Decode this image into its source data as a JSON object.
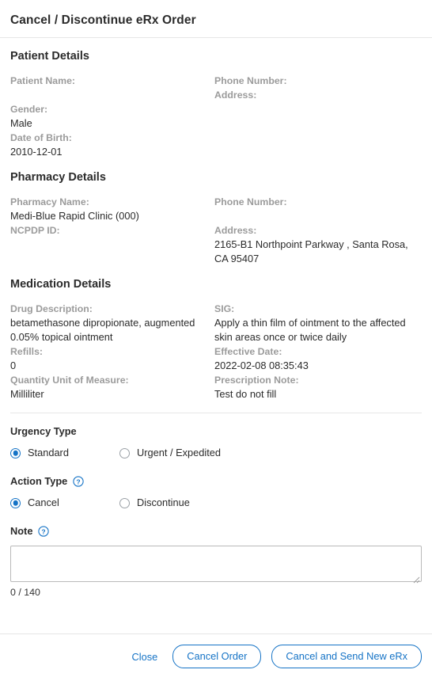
{
  "modal": {
    "title": "Cancel / Discontinue eRx Order"
  },
  "patient_details": {
    "heading": "Patient Details",
    "patient_name_label": "Patient Name:",
    "patient_name_value": "",
    "phone_number_label": "Phone Number:",
    "phone_number_value": "",
    "address_label": "Address:",
    "address_value": "",
    "gender_label": "Gender:",
    "gender_value": "Male",
    "dob_label": "Date of Birth:",
    "dob_value": "2010-12-01"
  },
  "pharmacy_details": {
    "heading": "Pharmacy Details",
    "pharmacy_name_label": "Pharmacy Name:",
    "pharmacy_name_value": "Medi-Blue Rapid Clinic (000)",
    "ncpdp_label": "NCPDP ID:",
    "ncpdp_value": "",
    "phone_number_label": "Phone Number:",
    "phone_number_value": "",
    "address_label": "Address:",
    "address_value": "2165-B1 Northpoint Parkway , Santa Rosa, CA 95407"
  },
  "medication_details": {
    "heading": "Medication Details",
    "drug_description_label": "Drug Description:",
    "drug_description_value": "betamethasone dipropionate, augmented 0.05% topical ointment",
    "refills_label": "Refills:",
    "refills_value": "0",
    "quantity_unit_label": "Quantity Unit of Measure:",
    "quantity_unit_value": "Milliliter",
    "sig_label": "SIG:",
    "sig_value": "Apply a thin film of ointment to the affected skin areas once or twice daily",
    "effective_date_label": "Effective Date:",
    "effective_date_value": "2022-02-08 08:35:43",
    "prescription_note_label": "Prescription Note:",
    "prescription_note_value": "Test do not fill"
  },
  "urgency_type": {
    "label": "Urgency Type",
    "options": [
      {
        "label": "Standard",
        "selected": true
      },
      {
        "label": "Urgent / Expedited",
        "selected": false
      }
    ]
  },
  "action_type": {
    "label": "Action Type",
    "help_icon": "help-circle-icon",
    "options": [
      {
        "label": "Cancel",
        "selected": true
      },
      {
        "label": "Discontinue",
        "selected": false
      }
    ]
  },
  "note": {
    "label": "Note",
    "help_icon": "help-circle-icon",
    "value": "",
    "placeholder": "",
    "counter": "0 / 140",
    "max_length": 140
  },
  "footer": {
    "close_label": "Close",
    "cancel_order_label": "Cancel Order",
    "cancel_and_send_label": "Cancel and Send New eRx"
  },
  "colors": {
    "accent": "#1573c6",
    "label_gray": "#9b9b9b",
    "text": "#2b2b2b",
    "divider": "#e6e6e6"
  }
}
